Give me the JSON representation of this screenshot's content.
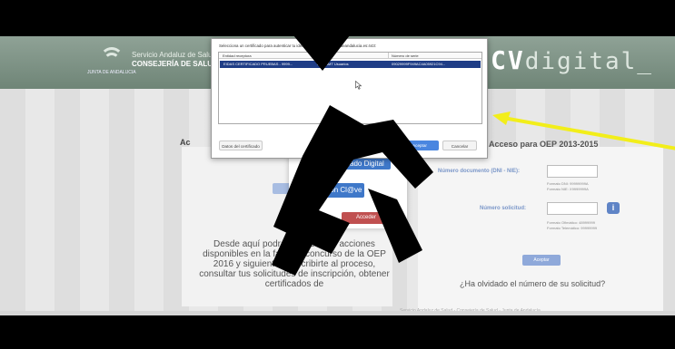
{
  "certificate_dialog": {
    "title": "Selecciona un certificado para autenticar tu identidad en ws117.juntadeandalucia.es:443:",
    "columns": [
      "Entidad receptora",
      "Emisor",
      "Número de serie"
    ],
    "rows": [
      {
        "entity": "EIDAS CERTIFICADO PRUEBAS - 9999...",
        "issuer": "AC FNMT Usuarios",
        "serial": "09029999F949AC4A05921C94..."
      }
    ],
    "details_button": "Datos del certificado",
    "accept_button": "Aceptar",
    "cancel_button": "Cancelar"
  },
  "header": {
    "org_line1": "Servicio Andaluz de Salud",
    "org_line2": "CONSEJERÍA DE SALUD",
    "logo_caption": "JUNTA DE ANDALUCIA",
    "brand_prefix": "CV",
    "brand_suffix": "digital_"
  },
  "left_panel": {
    "title": "Ac",
    "cert_button": "Con Certificado Digital",
    "clave_button": "Con Cl@ve",
    "red_button": "Acceder",
    "description": "Desde aquí podrás realizar las acciones disponibles en la fase de concurso de la OEP 2016 y siguientes (inscribirte al proceso, consultar tus solicitudes de inscripción, obtener certificados de"
  },
  "right_panel": {
    "title": "Acceso para OEP 2013-2015",
    "doc_label": "Número documento (DNI - NIE):",
    "doc_hint": "Formato DNI: 99999999A\nFormato NIE: X9999999A",
    "request_label": "Número solicitud:",
    "request_hint": "Formato Ofimático: 48999999\nFormato Telemático: 99999999",
    "info_icon": "i",
    "accept_button": "Aceptar",
    "forgot_link": "¿Ha olvidado el número de su solicitud?"
  },
  "footer": {
    "link": "Servicio Andaluz de Salud - Consejería de Salud - Junta de Andalucía"
  },
  "overlay": {
    "watermark": "MW",
    "arrow_color": "#f2ee1a"
  }
}
